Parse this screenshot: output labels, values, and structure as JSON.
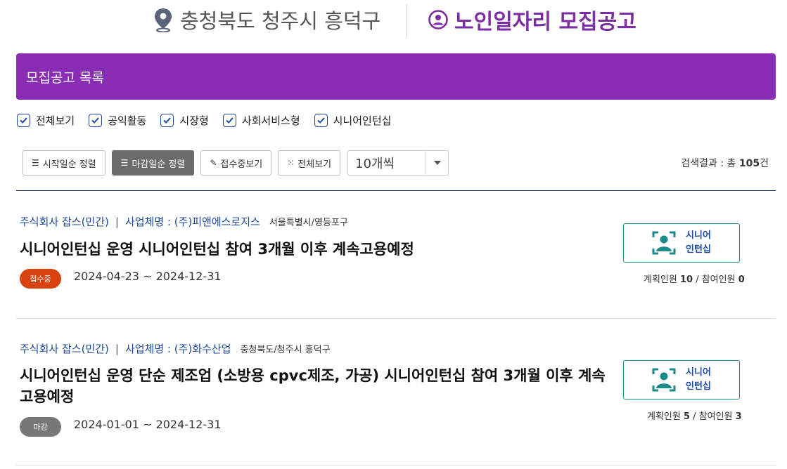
{
  "header": {
    "region": "충청북도 청주시 흥덕구",
    "title": "노인일자리 모집공고"
  },
  "list_bar": {
    "title": "모집공고 목록"
  },
  "filters": [
    {
      "label": "전체보기",
      "checked": true
    },
    {
      "label": "공익활동",
      "checked": true
    },
    {
      "label": "시장형",
      "checked": true
    },
    {
      "label": "사회서비스형",
      "checked": true
    },
    {
      "label": "시니어인턴십",
      "checked": true
    }
  ],
  "toolbar": {
    "sort_start": "시작일순 정렬",
    "sort_deadline": "마감일순 정렬",
    "view_open": "접수중보기",
    "view_all": "전체보기",
    "page_size": "10개씩"
  },
  "result": {
    "prefix": "검색결과 : 총 ",
    "count": "105",
    "suffix": "건"
  },
  "jobs": [
    {
      "org": "주식회사 잡스(민간)",
      "company": "사업체명 : (주)피앤에스로지스",
      "location": "서울특별시/영등포구",
      "title": "시니어인턴십 운영 시니어인턴십 참여 3개월 이후 계속고용예정",
      "status": "접수중",
      "status_color": "#d9410f",
      "dates": "2024-04-23 ~ 2024-12-31",
      "type_line1": "시니어",
      "type_line2": "인턴십",
      "planned_label": "계획인원 ",
      "planned": "10",
      "joined_label": " / 참여인원 ",
      "joined": "0"
    },
    {
      "org": "주식회사 잡스(민간)",
      "company": "사업체명 : (주)화수산업",
      "location": "충청북도/청주시 흥덕구",
      "title": "시니어인턴십 운영 단순 제조업 (소방용 cpvc제조, 가공) 시니어인턴십 참여 3개월 이후 계속고용예정",
      "status": "마감",
      "status_color": "#777777",
      "dates": "2024-01-01 ~ 2024-12-31",
      "type_line1": "시니어",
      "type_line2": "인턴십",
      "planned_label": "계획인원 ",
      "planned": "5",
      "joined_label": " / 참여인원 ",
      "joined": "3"
    }
  ]
}
